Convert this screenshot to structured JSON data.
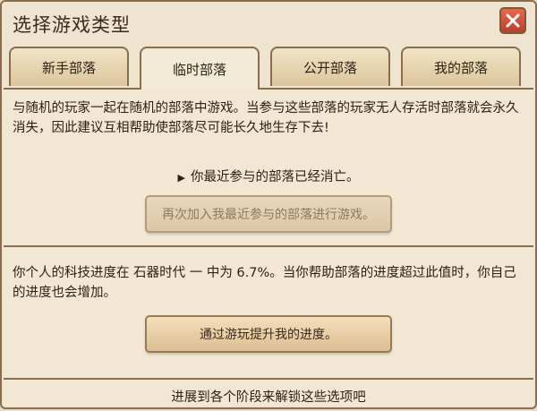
{
  "window": {
    "title": "选择游戏类型"
  },
  "tabs": [
    {
      "label": "新手部落"
    },
    {
      "label": "临时部落"
    },
    {
      "label": "公开部落"
    },
    {
      "label": "我的部落"
    }
  ],
  "active_tab": "临时部落",
  "temporary": {
    "description": "与随机的玩家一起在随机的部落中游戏。当参与这些部落的玩家无人存活时部落就会永久消失，因此建议互相帮助使部落尽可能长久地生存下去!",
    "notice": "你最近参与的部落已经消亡。",
    "rejoin_button": "再次加入我最近参与的部落进行游戏。"
  },
  "progress": {
    "text": "你个人的科技进度在 石器时代 一 中为 6.7%。当你帮助部落的进度超过此值时，你自己的进度也会增加。",
    "value_percent": 6.7,
    "button": "通过游玩提升我的进度。"
  },
  "footer": {
    "text": "进展到各个阶段来解锁这些选项吧"
  },
  "colors": {
    "close_button": "#d4553c",
    "border": "#8a6d4e",
    "panel_bg": "#f1e7d3"
  }
}
